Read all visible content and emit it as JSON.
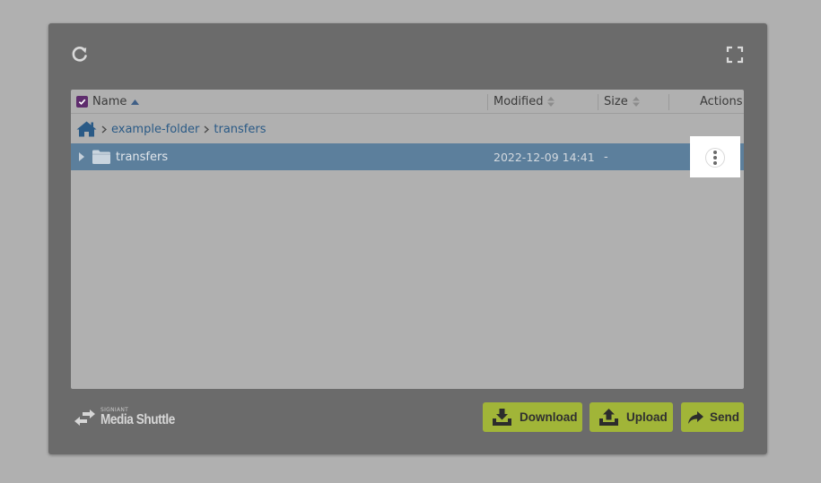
{
  "toolbar": {
    "refresh_icon": "refresh-icon",
    "fullscreen_icon": "fullscreen-icon"
  },
  "columns": {
    "name": "Name",
    "modified": "Modified",
    "size": "Size",
    "actions": "Actions"
  },
  "breadcrumb": {
    "home_icon": "home-icon",
    "items": [
      "example-folder",
      "transfers"
    ]
  },
  "files": [
    {
      "name": "transfers",
      "type": "folder",
      "modified": "2022-12-09 14:41",
      "size": "-",
      "selected": true
    }
  ],
  "brand": {
    "small": "SIGNIANT",
    "name": "Media Shuttle"
  },
  "buttons": {
    "download": "Download",
    "upload": "Upload",
    "send": "Send"
  },
  "colors": {
    "panel": "#6b6b6b",
    "background": "#b0b0b0",
    "selected_row": "#5c7f9c",
    "link": "#2a5a86",
    "button": "#a1b538",
    "checkbox": "#5e2c6d"
  }
}
